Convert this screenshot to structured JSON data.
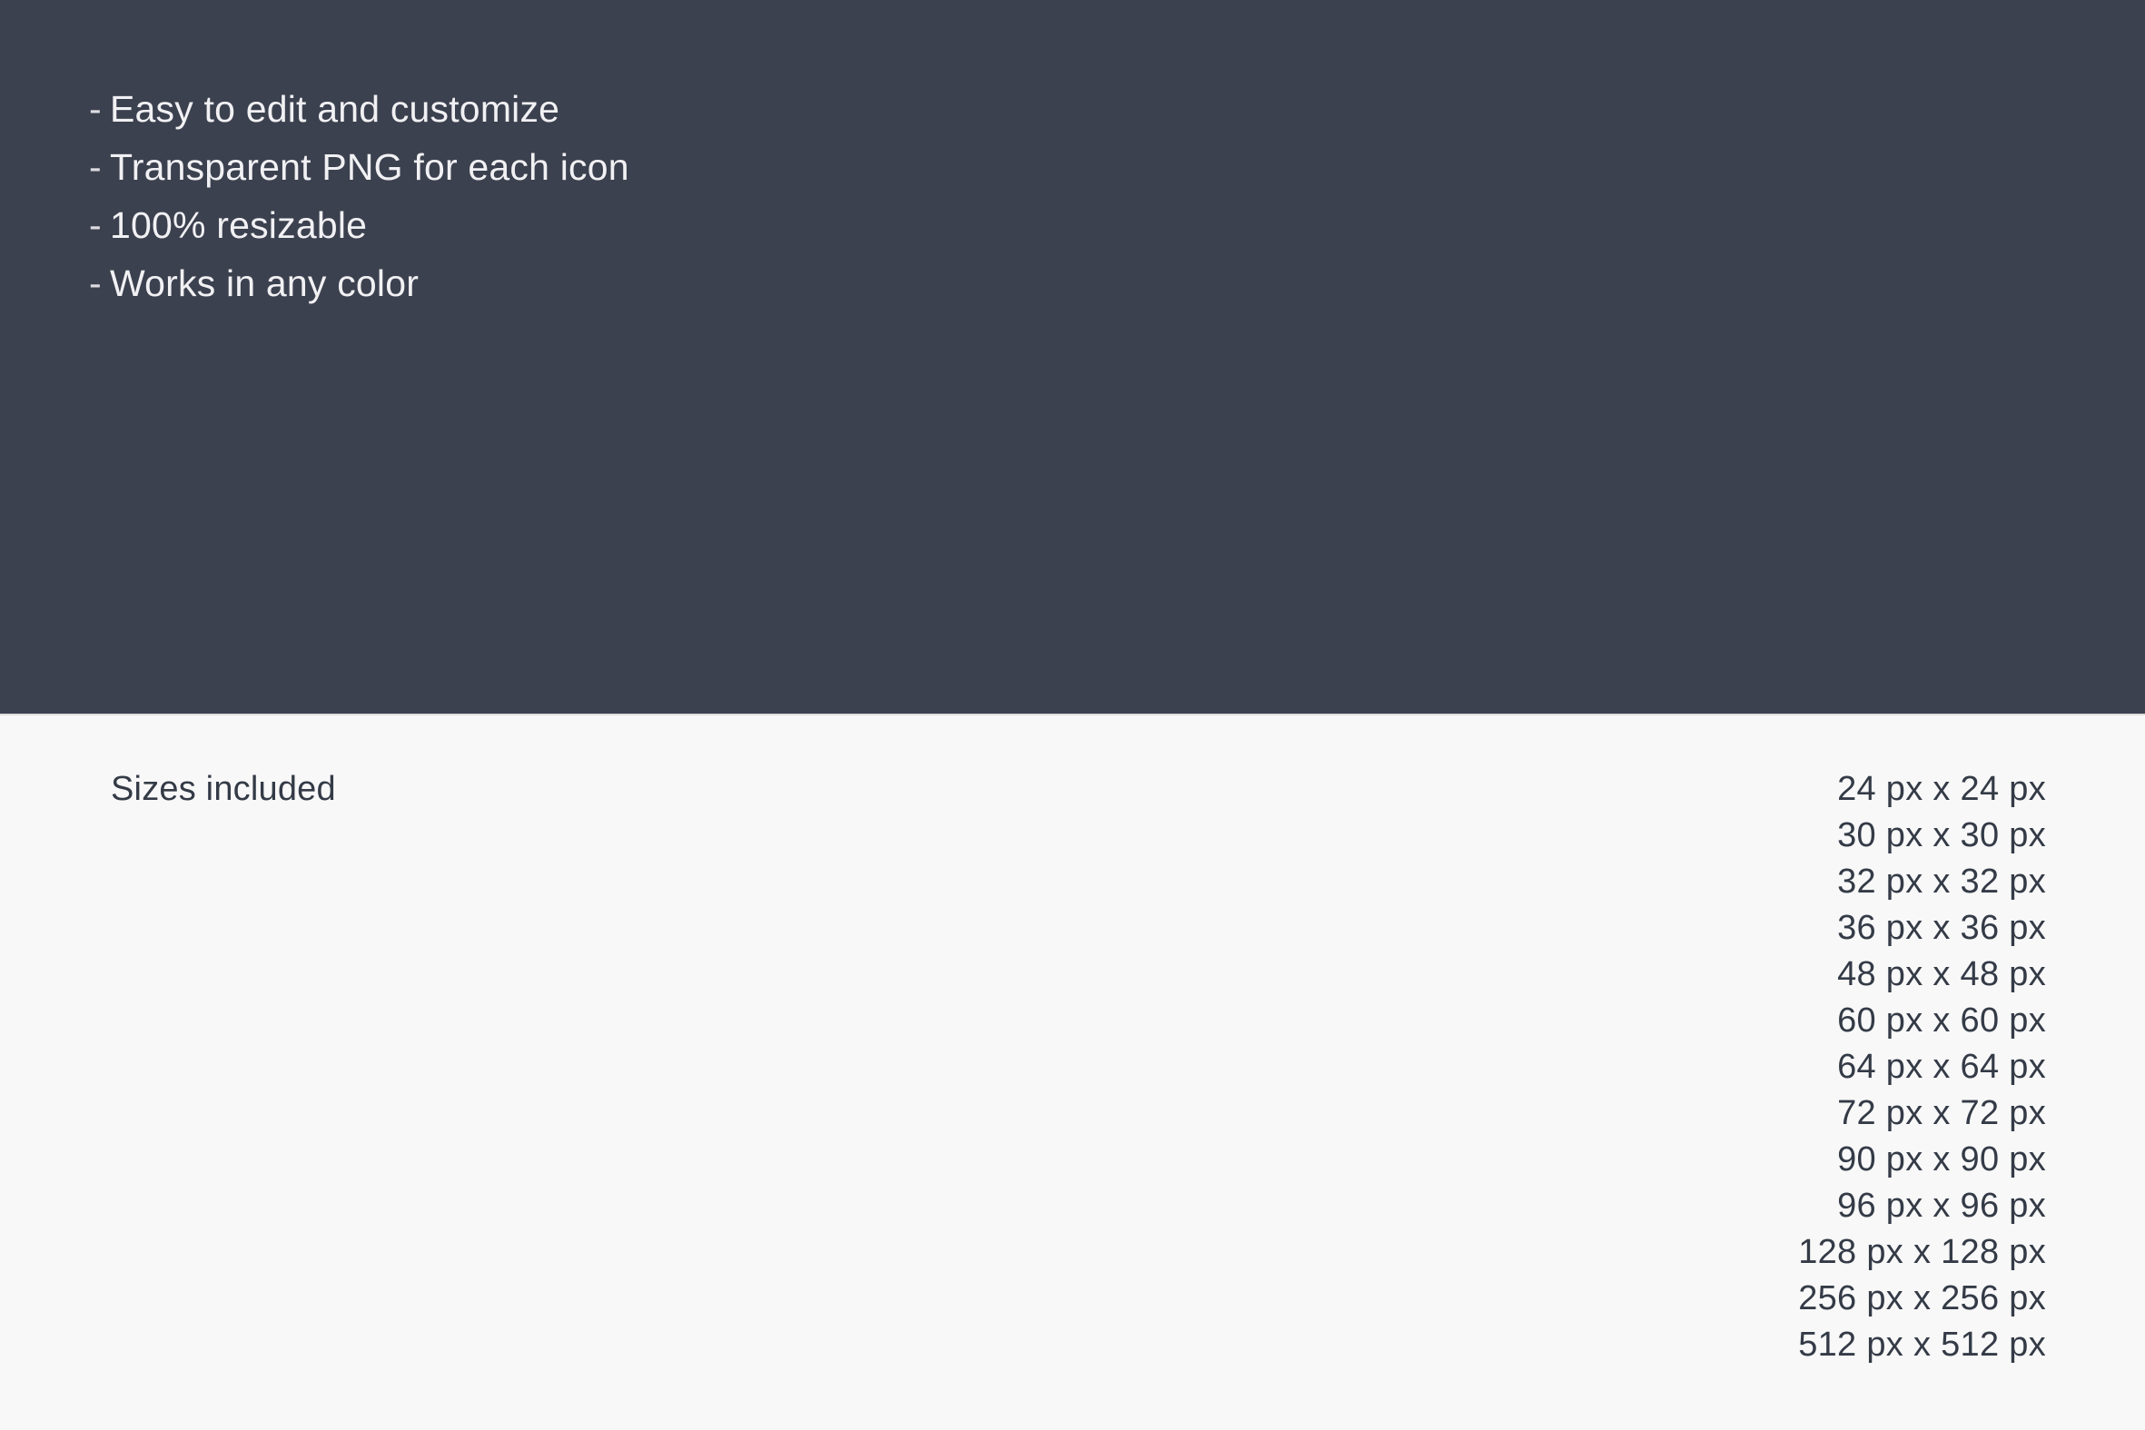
{
  "hero": {
    "background_color": "#3c414f",
    "text_color": "#f1f1f4",
    "bullet_marker": "-",
    "features": [
      {
        "text": "Easy to edit and customize"
      },
      {
        "text": "Transparent PNG for each icon"
      },
      {
        "text": "100% resizable"
      },
      {
        "text": "Works in any color"
      }
    ]
  },
  "sizes_section": {
    "background_color": "#f8f8f8",
    "text_color": "#343b47",
    "label": "Sizes included",
    "sizes": [
      "24 px x 24 px",
      "30 px x 30 px",
      "32 px x 32 px",
      "36 px x 36 px",
      "48 px x 48 px",
      "60 px x 60 px",
      "64 px x 64 px",
      "72 px x 72 px",
      "90 px x 90 px",
      "96 px x 96 px",
      "128 px x 128 px",
      "256 px x 256 px",
      "512 px x 512 px"
    ]
  }
}
